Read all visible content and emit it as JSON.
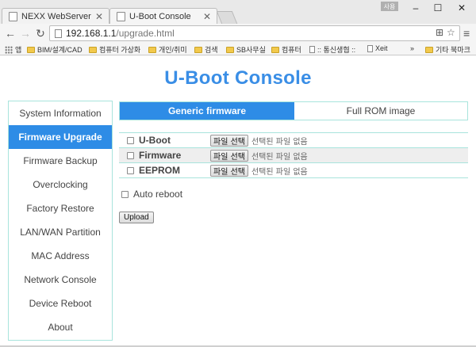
{
  "browser": {
    "tabs": [
      {
        "title": "NEXX WebServer",
        "active": false
      },
      {
        "title": "U-Boot Console",
        "active": true
      }
    ],
    "user_badge": "사용",
    "window_controls": {
      "minimize": "–",
      "maximize": "☐",
      "close": "✕"
    },
    "nav": {
      "back": "←",
      "forward": "→",
      "reload": "↻"
    },
    "url_host": "192.168.1.1",
    "url_path": "/upgrade.html",
    "bookmarks": [
      {
        "label": "앱",
        "type": "apps"
      },
      {
        "label": "BIM/설계/CAD",
        "type": "folder"
      },
      {
        "label": "컴퓨터 가상화",
        "type": "folder"
      },
      {
        "label": "개인/취미",
        "type": "folder"
      },
      {
        "label": "검색",
        "type": "folder"
      },
      {
        "label": "SB사무실",
        "type": "folder"
      },
      {
        "label": "컴퓨터",
        "type": "folder"
      },
      {
        "label": ":: 통신생협 ::",
        "type": "page"
      },
      {
        "label": "Xeit",
        "type": "page"
      }
    ],
    "bookmarks_overflow": "»",
    "other_bookmarks": "기타 북마크"
  },
  "page": {
    "title": "U-Boot Console",
    "sidebar": [
      {
        "label": "System Information",
        "active": false
      },
      {
        "label": "Firmware Upgrade",
        "active": true
      },
      {
        "label": "Firmware Backup",
        "active": false
      },
      {
        "label": "Overclocking",
        "active": false
      },
      {
        "label": "Factory Restore",
        "active": false
      },
      {
        "label": "LAN/WAN Partition",
        "active": false
      },
      {
        "label": "MAC Address",
        "active": false
      },
      {
        "label": "Network Console",
        "active": false
      },
      {
        "label": "Device Reboot",
        "active": false
      },
      {
        "label": "About",
        "active": false
      }
    ],
    "tabs": {
      "generic": "Generic firmware",
      "full_rom": "Full ROM image"
    },
    "rows": [
      {
        "label": "U-Boot",
        "button": "파일 선택",
        "status": "선택된 파일 없음"
      },
      {
        "label": "Firmware",
        "button": "파일 선택",
        "status": "선택된 파일 없음"
      },
      {
        "label": "EEPROM",
        "button": "파일 선택",
        "status": "선택된 파일 없음"
      }
    ],
    "auto_reboot": "Auto reboot",
    "upload": "Upload"
  }
}
